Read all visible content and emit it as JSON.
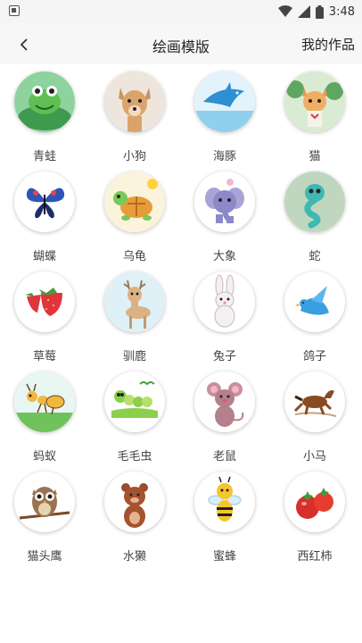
{
  "status": {
    "time": "3:48"
  },
  "header": {
    "title": "绘画模版",
    "my_works": "我的作品"
  },
  "items": [
    {
      "label": "青蛙",
      "icon": "frog-icon"
    },
    {
      "label": "小狗",
      "icon": "dog-icon"
    },
    {
      "label": "海豚",
      "icon": "dolphin-icon"
    },
    {
      "label": "猫",
      "icon": "cat-icon"
    },
    {
      "label": "蝴蝶",
      "icon": "butterfly-icon"
    },
    {
      "label": "乌龟",
      "icon": "turtle-icon"
    },
    {
      "label": "大象",
      "icon": "elephant-icon"
    },
    {
      "label": "蛇",
      "icon": "snake-icon"
    },
    {
      "label": "草莓",
      "icon": "strawberry-icon"
    },
    {
      "label": "驯鹿",
      "icon": "reindeer-icon"
    },
    {
      "label": "兔子",
      "icon": "rabbit-icon"
    },
    {
      "label": "鸽子",
      "icon": "pigeon-icon"
    },
    {
      "label": "蚂蚁",
      "icon": "ant-icon"
    },
    {
      "label": "毛毛虫",
      "icon": "caterpillar-icon"
    },
    {
      "label": "老鼠",
      "icon": "mouse-icon"
    },
    {
      "label": "小马",
      "icon": "horse-icon"
    },
    {
      "label": "猫头鹰",
      "icon": "owl-icon"
    },
    {
      "label": "水獭",
      "icon": "otter-icon"
    },
    {
      "label": "蜜蜂",
      "icon": "bee-icon"
    },
    {
      "label": "西红柿",
      "icon": "tomato-icon"
    }
  ]
}
